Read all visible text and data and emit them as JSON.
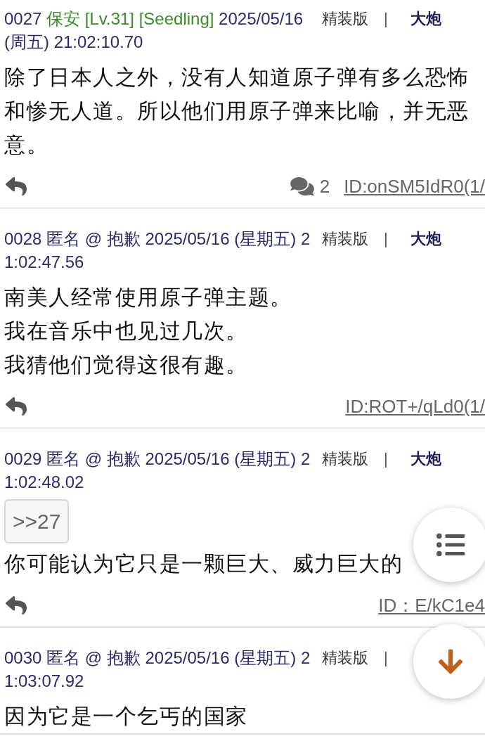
{
  "posts": [
    {
      "number": "0027",
      "author": "保安 [Lv.31] [Seedling]",
      "color": "#3a8a2a",
      "datetime": "2025/05/16 (周五) 21:02:10.70",
      "edition": "精装版",
      "separator": "|",
      "tag": "大炮",
      "body": [
        "除了日本人之外，没有人知道原子弹有多么恐怖和惨无人道。所以他们用原子弹来比喻，并无恶意。"
      ],
      "comment_count": "2",
      "id": "ID:onSM5IdR0(1/"
    },
    {
      "number": "0028",
      "author": "匿名 @ 抱歉",
      "color": "#2b2b6b",
      "datetime": "2025/05/16 (星期五) 21:02:47.56",
      "edition": "精装版",
      "separator": "|",
      "tag": "大炮",
      "body": [
        "南美人经常使用原子弹主题。",
        "我在音乐中也见过几次。",
        "我猜他们觉得这很有趣。"
      ],
      "id": "ID:ROT+/qLd0(1/"
    },
    {
      "number": "0029",
      "author": "匿名 @ 抱歉",
      "color": "#2b2b6b",
      "datetime": "2025/05/16 (星期五) 21:02:48.02",
      "edition": "精装版",
      "separator": "|",
      "tag": "大炮",
      "quote": ">>27",
      "body": [
        "你可能认为它只是一颗巨大、威力巨大的"
      ],
      "id": "ID：E/kC1e4"
    },
    {
      "number": "0030",
      "author": "匿名 @ 抱歉",
      "color": "#2b2b6b",
      "datetime": "2025/05/16 (星期五) 21:03:07.92",
      "edition": "精装版",
      "separator": "|",
      "body": [
        "因为它是一个乞丐的国家"
      ]
    }
  ]
}
